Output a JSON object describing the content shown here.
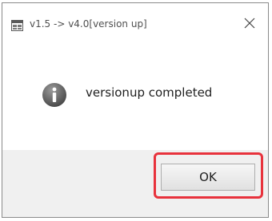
{
  "dialog": {
    "title": "v1.5 -> v4.0[version up]",
    "message": "versionup completed",
    "ok_label": "OK"
  },
  "icons": {
    "app": "window-app-icon",
    "close": "close-icon",
    "info": "info-icon"
  },
  "colors": {
    "highlight": "#e8323c",
    "footer_bg": "#f0f0f0",
    "info_icon": "#555555"
  }
}
